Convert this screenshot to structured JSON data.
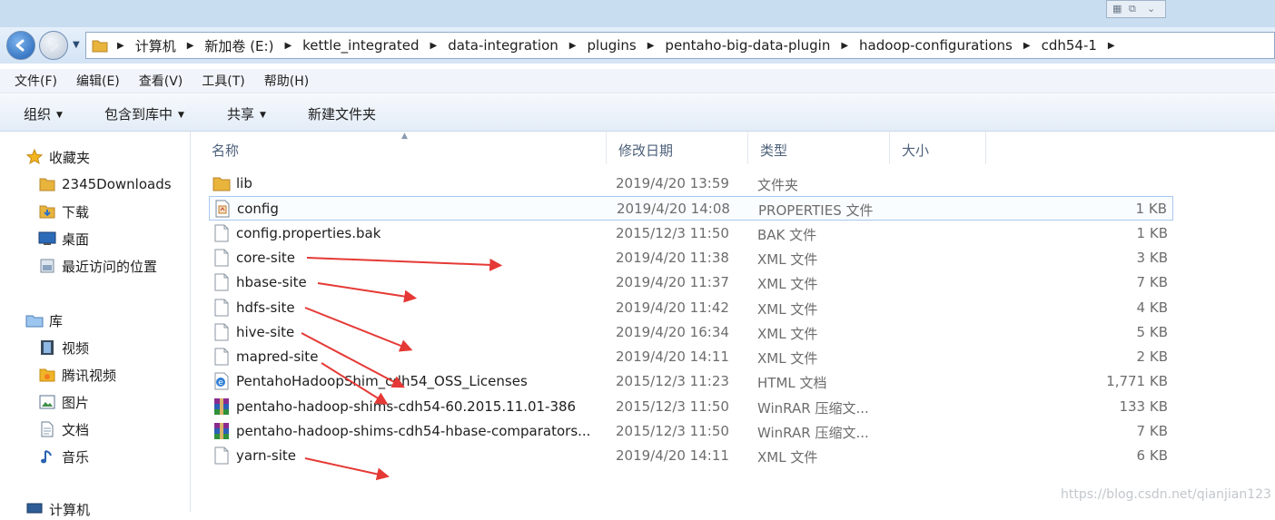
{
  "window": {
    "controls_icon": "restore-grid-icon",
    "address_crumbs": [
      "计算机",
      "新加卷 (E:)",
      "kettle_integrated",
      "data-integration",
      "plugins",
      "pentaho-big-data-plugin",
      "hadoop-configurations",
      "cdh54-1"
    ]
  },
  "menu": [
    "文件(F)",
    "编辑(E)",
    "查看(V)",
    "工具(T)",
    "帮助(H)"
  ],
  "toolbar": {
    "organize": "组织",
    "include_in_library": "包含到库中",
    "share": "共享",
    "new_folder": "新建文件夹"
  },
  "nav": {
    "favorites_label": "收藏夹",
    "favorites": [
      "2345Downloads",
      "下载",
      "桌面",
      "最近访问的位置"
    ],
    "libraries_label": "库",
    "libraries": [
      "视频",
      "腾讯视频",
      "图片",
      "文档",
      "音乐"
    ],
    "computer_label": "计算机"
  },
  "columns": {
    "name": "名称",
    "modified": "修改日期",
    "type": "类型",
    "size": "大小"
  },
  "files": [
    {
      "name": "lib",
      "date": "2019/4/20 13:59",
      "type": "文件夹",
      "size": "",
      "icon": "folder-icon"
    },
    {
      "name": "config",
      "date": "2019/4/20 14:08",
      "type": "PROPERTIES 文件",
      "size": "1 KB",
      "icon": "properties-file-icon"
    },
    {
      "name": "config.properties.bak",
      "date": "2015/12/3 11:50",
      "type": "BAK 文件",
      "size": "1 KB",
      "icon": "file-icon"
    },
    {
      "name": "core-site",
      "date": "2019/4/20 11:38",
      "type": "XML 文件",
      "size": "3 KB",
      "icon": "xml-file-icon"
    },
    {
      "name": "hbase-site",
      "date": "2019/4/20 11:37",
      "type": "XML 文件",
      "size": "7 KB",
      "icon": "xml-file-icon"
    },
    {
      "name": "hdfs-site",
      "date": "2019/4/20 11:42",
      "type": "XML 文件",
      "size": "4 KB",
      "icon": "xml-file-icon"
    },
    {
      "name": "hive-site",
      "date": "2019/4/20 16:34",
      "type": "XML 文件",
      "size": "5 KB",
      "icon": "xml-file-icon"
    },
    {
      "name": "mapred-site",
      "date": "2019/4/20 14:11",
      "type": "XML 文件",
      "size": "2 KB",
      "icon": "xml-file-icon"
    },
    {
      "name": "PentahoHadoopShim_cdh54_OSS_Licenses",
      "date": "2015/12/3 11:23",
      "type": "HTML 文档",
      "size": "1,771 KB",
      "icon": "ie-html-icon"
    },
    {
      "name": "pentaho-hadoop-shims-cdh54-60.2015.11.01-386",
      "date": "2015/12/3 11:50",
      "type": "WinRAR 压缩文...",
      "size": "133 KB",
      "icon": "winrar-icon"
    },
    {
      "name": "pentaho-hadoop-shims-cdh54-hbase-comparators...",
      "date": "2015/12/3 11:50",
      "type": "WinRAR 压缩文...",
      "size": "7 KB",
      "icon": "winrar-icon"
    },
    {
      "name": "yarn-site",
      "date": "2019/4/20 14:11",
      "type": "XML 文件",
      "size": "6 KB",
      "icon": "xml-file-icon"
    }
  ],
  "watermark": "https://blog.csdn.net/qianjian123",
  "colors": {
    "annotation_arrow": "#e53935",
    "selection_border": "#a8c8ef",
    "address_bg": "#d4e4f5"
  }
}
